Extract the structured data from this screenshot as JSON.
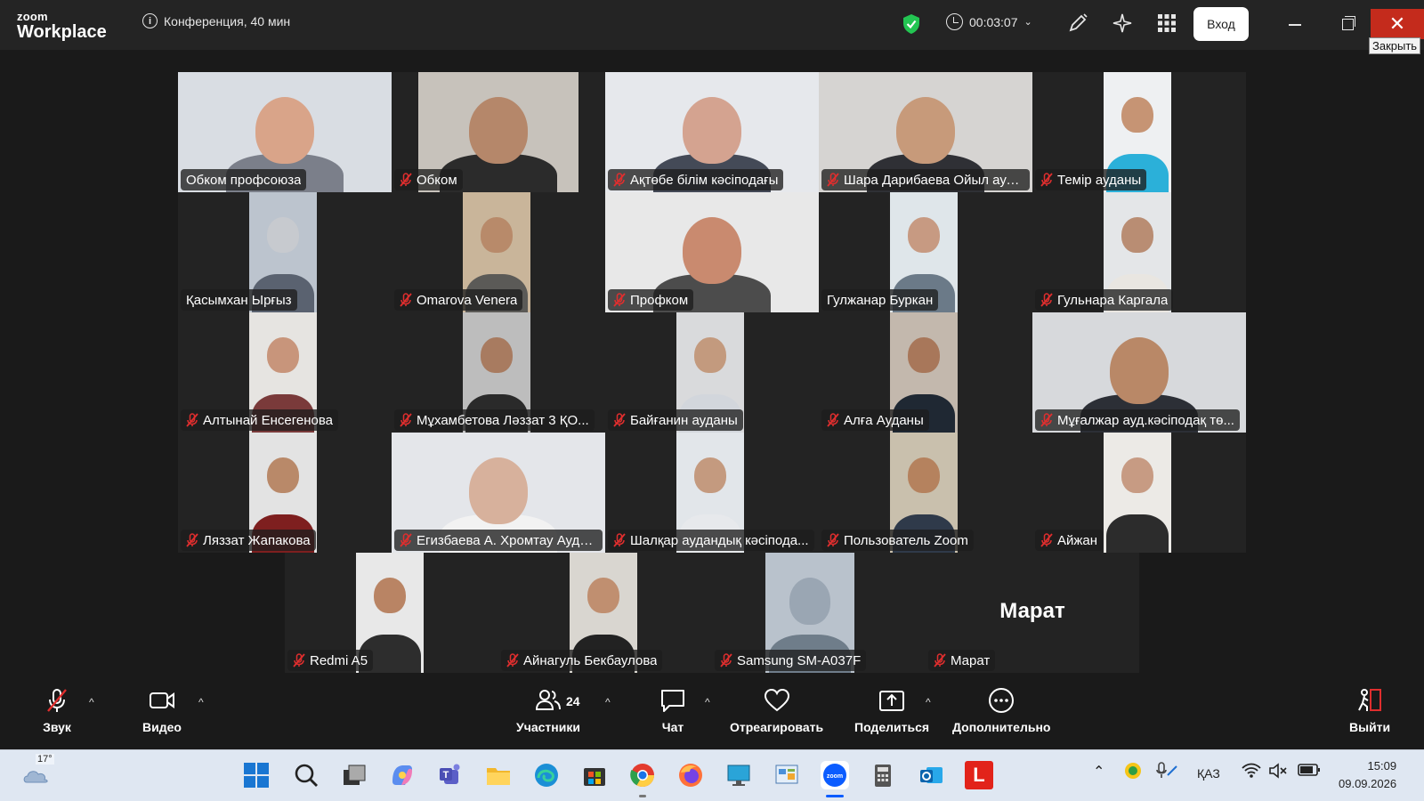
{
  "app": {
    "logo_line1": "zoom",
    "logo_line2": "Workplace",
    "meeting_info": "Конференция, 40 мин",
    "timer": "00:03:07",
    "login_button": "Вход",
    "close_tooltip": "Закрыть"
  },
  "participants": [
    {
      "name": "Обком профсоюза",
      "muted": false,
      "speaking": true
    },
    {
      "name": "Обком",
      "muted": true
    },
    {
      "name": "Ақтөбе білім кәсіподағы",
      "muted": true
    },
    {
      "name": "Шара Дарибаева Ойыл ауд...",
      "muted": true
    },
    {
      "name": "Темір ауданы",
      "muted": true
    },
    {
      "name": "Қасымхан Ырғыз",
      "muted": false
    },
    {
      "name": "Omarova Venera",
      "muted": true
    },
    {
      "name": "Профком",
      "muted": true
    },
    {
      "name": "Гулжанар Буркан",
      "muted": false
    },
    {
      "name": "Гульнара Каргала",
      "muted": true
    },
    {
      "name": "Алтынай Енсегенова",
      "muted": true
    },
    {
      "name": "Мұхамбетова Ләззат 3 ҚО...",
      "muted": true
    },
    {
      "name": "Байғанин ауданы",
      "muted": true
    },
    {
      "name": "Алға Ауданы",
      "muted": true
    },
    {
      "name": "Мұғалжар ауд.кәсіподақ тө...",
      "muted": true
    },
    {
      "name": "Ляззат Жапакова",
      "muted": true
    },
    {
      "name": "Егизбаева А. Хромтау Ауда...",
      "muted": true
    },
    {
      "name": "Шалқар аудандық кәсіпода...",
      "muted": true
    },
    {
      "name": "Пользователь Zoom",
      "muted": true
    },
    {
      "name": "Айжан",
      "muted": true
    },
    {
      "name": "Redmi A5",
      "muted": true
    },
    {
      "name": "Айнагуль Бекбаулова",
      "muted": true
    },
    {
      "name": "Samsung SM-A037F",
      "muted": true
    },
    {
      "name": "Марат",
      "muted": true,
      "no_video": true,
      "center_label": "Марат"
    }
  ],
  "toolbar": {
    "audio": "Звук",
    "video": "Видео",
    "participants": "Участники",
    "participants_count": "24",
    "chat": "Чат",
    "react": "Отреагировать",
    "share": "Поделиться",
    "more": "Дополнительно",
    "leave": "Выйти"
  },
  "taskbar": {
    "temperature": "17°",
    "language": "ҚАЗ",
    "time": "15:09",
    "date": "09.09.2026"
  },
  "colors": {
    "speaking_outline": "#24d15a",
    "muted_icon": "#e02e2e",
    "close_button": "#c42b1c"
  }
}
